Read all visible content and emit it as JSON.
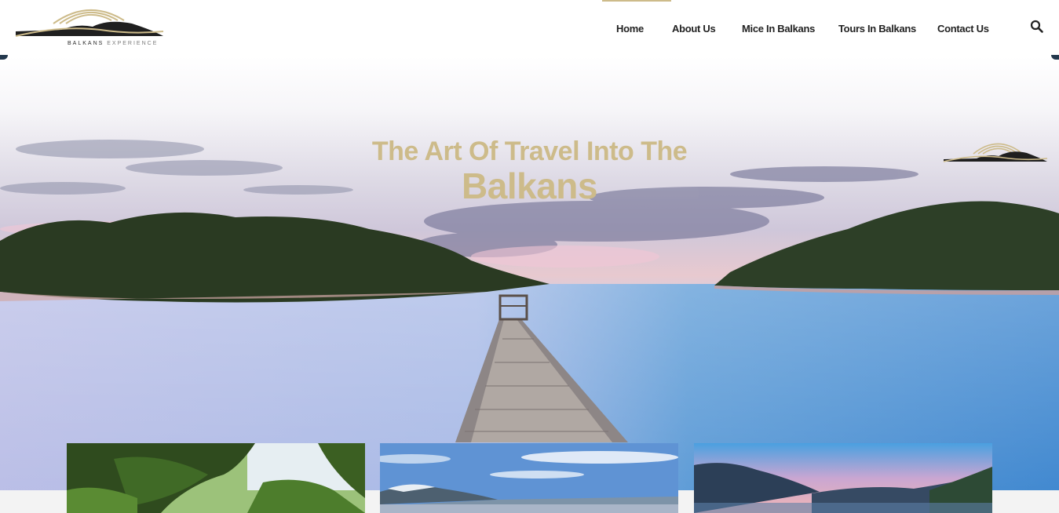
{
  "brand": {
    "name_bold": "BALKANS",
    "name_light": "EXPERIENCE",
    "logo_icon": "mountains-sun-logo"
  },
  "nav": {
    "items": [
      {
        "label": "Home",
        "active": true
      },
      {
        "label": "About Us",
        "active": false
      },
      {
        "label": "Mice In Balkans",
        "active": false
      },
      {
        "label": "Tours In Balkans",
        "active": false
      },
      {
        "label": "Contact Us",
        "active": false
      }
    ],
    "search_icon": "search-icon"
  },
  "hero": {
    "title_line1": "The Art Of Travel Into The",
    "title_line2": "Balkans",
    "accent_color": "#cdbb8a"
  },
  "cards": [
    {
      "image": "forest-lake-photo"
    },
    {
      "image": "mountain-lake-photo"
    },
    {
      "image": "bay-sunset-photo"
    }
  ]
}
